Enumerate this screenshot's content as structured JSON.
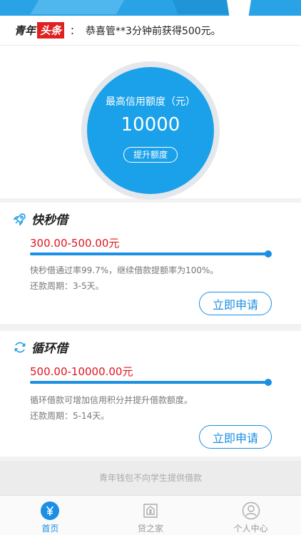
{
  "news": {
    "logo_part1": "青年",
    "logo_part2": "头条",
    "colon": "：",
    "text": "恭喜管**3分钟前获得500元。"
  },
  "hero": {
    "title": "最高信用额度（元）",
    "value": "10000",
    "button": "提升额度"
  },
  "products": [
    {
      "title": "快秒借",
      "icon": "rocket-icon",
      "range": "300.00-500.00元",
      "progress": 1.0,
      "desc1": "快秒借通过率99.7%，继续借款提额率为100%。",
      "desc2": "还款周期：3-5天。",
      "button": "立即申请"
    },
    {
      "title": "循环借",
      "icon": "refresh-icon",
      "range": "500.00-10000.00元",
      "progress": 1.0,
      "desc1": "循环借款可增加信用积分并提升借款额度。",
      "desc2": "还款周期：5-14天。",
      "button": "立即申请"
    }
  ],
  "notice": "青年钱包不向学生提供借款",
  "tabs": [
    {
      "label": "首页",
      "icon": "yen-icon",
      "active": true
    },
    {
      "label": "贷之家",
      "icon": "house-icon",
      "active": false
    },
    {
      "label": "个人中心",
      "icon": "user-icon",
      "active": false
    }
  ],
  "colors": {
    "accent": "#1a8fe3",
    "circle": "#1aa1ea",
    "range_red": "#e0141e"
  }
}
